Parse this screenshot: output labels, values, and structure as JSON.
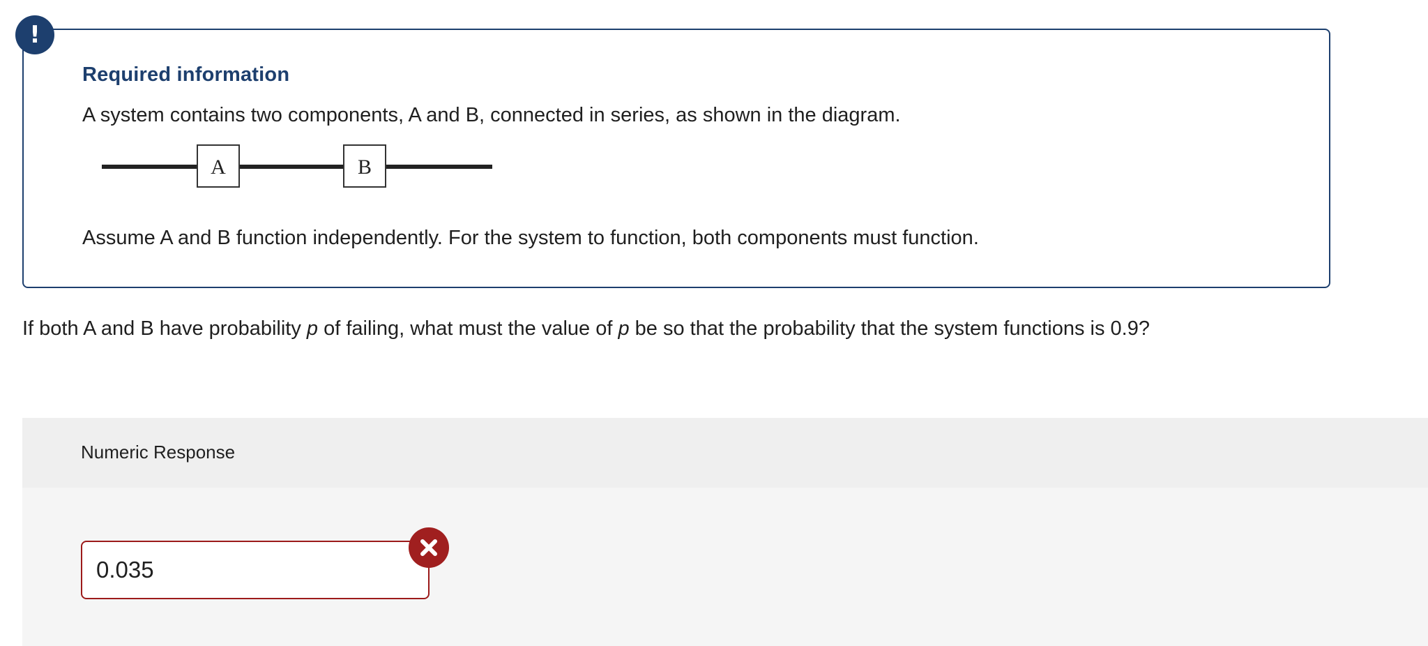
{
  "required_info": {
    "badge_glyph": "!",
    "title": "Required information",
    "intro_text": "A system contains two components, A and B, connected in series, as shown in the diagram.",
    "diagram": {
      "component_a": "A",
      "component_b": "B"
    },
    "assumption_text": "Assume A and B function independently. For the system to function, both components must function."
  },
  "question": {
    "part1": "If both A and B have probability ",
    "var1": "p",
    "part2": " of failing, what must the value of ",
    "var2": "p",
    "part3": " be so that the probability that the system functions is 0.9?"
  },
  "response": {
    "label": "Numeric Response",
    "value": "0.035",
    "status": "incorrect",
    "status_icon": "x-circle-icon"
  },
  "colors": {
    "accent": "#1d3f6e",
    "error": "#a01f1f",
    "panel_bg": "#f5f5f5",
    "panel_header_bg": "#efefef"
  }
}
